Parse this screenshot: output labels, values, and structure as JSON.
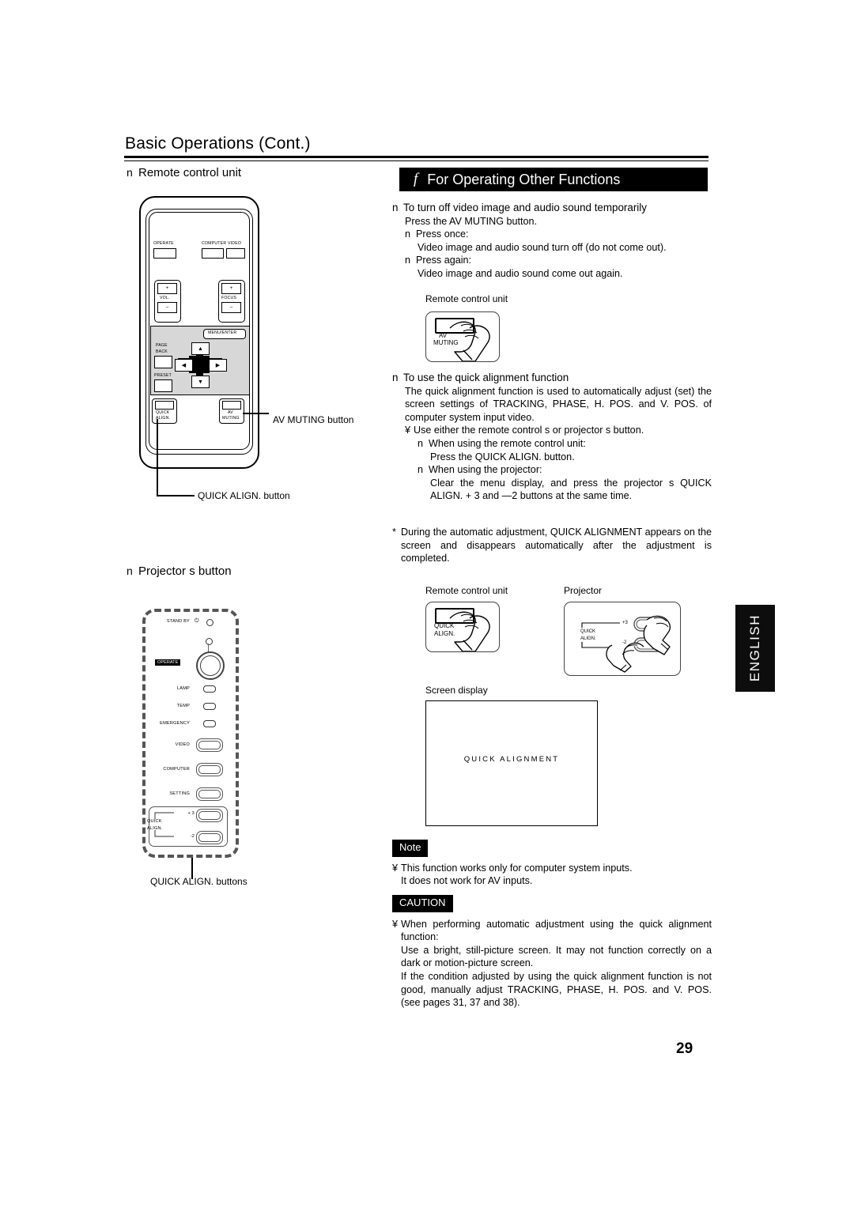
{
  "page": {
    "title": "Basic Operations (Cont.)",
    "number": "29",
    "side_tab": "ENGLISH"
  },
  "left_column": {
    "sub_remote": "Remote control unit",
    "sub_projector": "Projector s button",
    "bullet_marker": "n",
    "callouts": {
      "av_muting": "AV MUTING button",
      "quick_align_remote": "QUICK ALIGN. button",
      "quick_align_projector": "QUICK ALIGN. buttons"
    }
  },
  "remote_control": {
    "buttons": {
      "operate": "OPERATE",
      "computer": "COMPUTER",
      "video": "VIDEO",
      "vol": "VOL.",
      "focus": "FOCUS",
      "plus": "+",
      "minus": "–",
      "menu_enter": "MENU/ENTER",
      "page_back_1": "PAGE",
      "page_back_2": "BACK",
      "preset": "PRESET",
      "quick_align_1": "QUICK",
      "quick_align_2": "ALIGN.",
      "av_muting_1": "AV",
      "av_muting_2": "MUTING",
      "arrow_up": "▲",
      "arrow_down": "▼",
      "arrow_left": "◀",
      "arrow_right": "▶"
    }
  },
  "projector_panel": {
    "stand_by": "STAND BY",
    "power_glyph": "⏻",
    "operate": "OPERATE",
    "lamp": "LAMP",
    "temp": "TEMP",
    "emergency": "EMERGENCY",
    "video": "VIDEO",
    "computer": "COMPUTER",
    "setting": "SETTING",
    "quick_1": "QUICK",
    "quick_2": "ALIGN.",
    "plus3": "+ 3",
    "minus2": "-2"
  },
  "section": {
    "glyph": "f",
    "title": "For Operating Other Functions"
  },
  "av_muting_section": {
    "marker": "n",
    "heading": "To turn off video image and audio sound temporarily",
    "line1": "Press the AV MUTING button.",
    "sub1_marker": "n",
    "sub1_label": "Press once:",
    "sub1_text": "Video image and audio sound turn off (do not come out).",
    "sub2_marker": "n",
    "sub2_label": "Press again:",
    "sub2_text": "Video image and audio sound come out again."
  },
  "quick_align_section": {
    "marker": "n",
    "heading": "To use the quick alignment function",
    "para1": "The quick alignment function is used to automatically adjust (set) the screen settings of  TRACKING, PHASE, H. POS. and V. POS. of computer system input video.",
    "bullet_marker": "¥",
    "bullet_text": "Use either the remote control s or projector s button.",
    "sub1_marker": "n",
    "sub1_label": "When using the remote control unit:",
    "sub1_text": "Press the QUICK ALIGN. button.",
    "sub2_marker": "n",
    "sub2_label": "When using the projector:",
    "sub2_text": "Clear the menu display, and press the projector s QUICK ALIGN. + 3  and  —2  buttons at the same time.",
    "asterisk_marker": "*",
    "asterisk_text": "During the automatic adjustment,  QUICK ALIGNMENT  appears on the screen and disappears automatically after the adjustment is completed."
  },
  "figures": {
    "remote_control_unit_1": "Remote control unit",
    "remote_control_unit_2": "Remote control unit",
    "projector": "Projector",
    "screen_display": "Screen display",
    "screen_text": "QUICK ALIGNMENT",
    "key_av_muting_1": "AV",
    "key_av_muting_2": "MUTING",
    "key_quick_1": "QUICK",
    "key_quick_2": "ALIGN.",
    "proj_quick_1": "QUICK",
    "proj_quick_2": "ALIGN.",
    "proj_plus3": "+3",
    "proj_minus2": "-2"
  },
  "note": {
    "tag": "Note",
    "bullet": "¥",
    "line1": "This function works only for computer system inputs.",
    "line2": "It does not work for AV inputs."
  },
  "caution": {
    "tag": "CAUTION",
    "bullet": "¥",
    "para1": "When performing automatic adjustment using the quick alignment function:",
    "para2": "Use a bright, still-picture screen. It may not function correctly on a dark or motion-picture screen.",
    "para3": "If the condition adjusted by using the quick alignment function is not good, manually adjust TRACKING, PHASE, H. POS. and V. POS. (see pages 31, 37 and 38)."
  }
}
